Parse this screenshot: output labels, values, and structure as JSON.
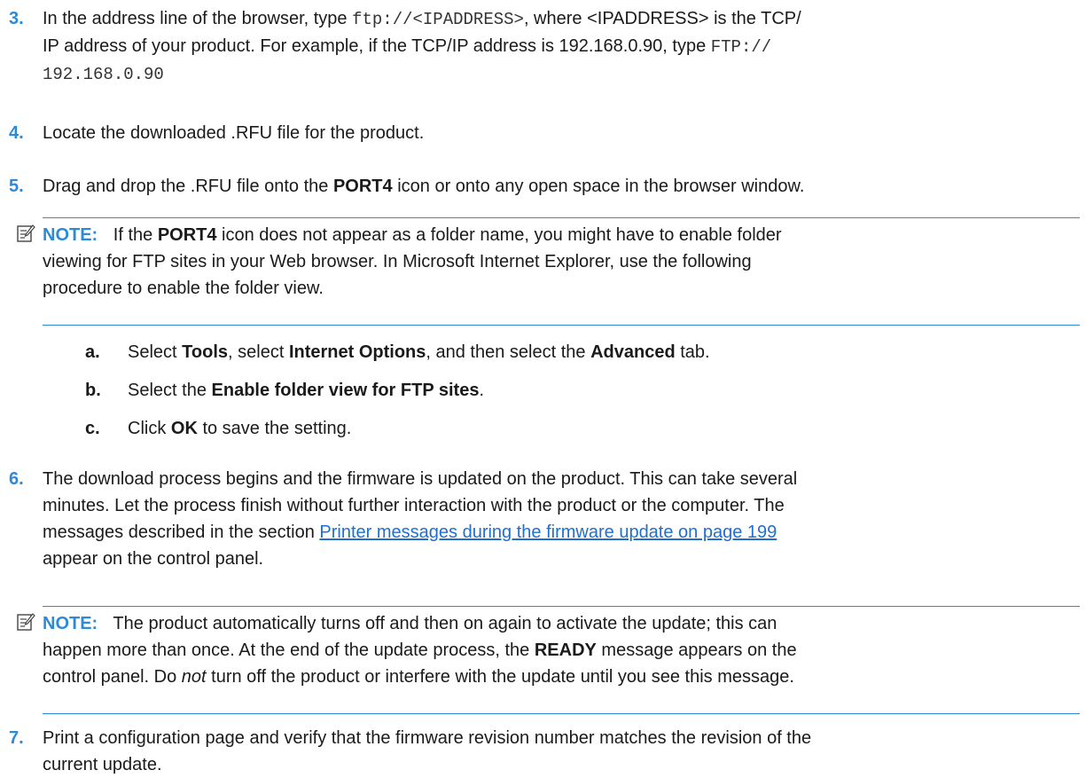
{
  "step3": {
    "number": "3.",
    "t1": "In the address line of the browser, type ",
    "code1": "ftp://<IPADDRESS>",
    "t2": ", where <IPADDRESS> is the TCP/",
    "t3": "IP address of your product. For example, if the TCP/IP address is 192.168.0.90, type ",
    "code2a": "FTP://",
    "code2b": "192.168.0.90"
  },
  "step4": {
    "number": "4.",
    "text": "Locate the downloaded .RFU file for the product."
  },
  "step5": {
    "number": "5.",
    "t1": "Drag and drop the .RFU file onto the ",
    "bold1": "PORT4",
    "t2": " icon or onto any open space in the browser window."
  },
  "note1": {
    "label": "NOTE:",
    "t1": "If the ",
    "bold1": "PORT4",
    "t2": " icon does not appear as a folder name, you might have to enable folder",
    "line2": "viewing for FTP sites in your Web browser. In Microsoft Internet Explorer, use the following",
    "line3": "procedure to enable the folder view."
  },
  "sub_a": {
    "letter": "a.",
    "t1": "Select ",
    "b1": "Tools",
    "t2": ", select ",
    "b2": "Internet Options",
    "t3": ", and then select the ",
    "b3": "Advanced",
    "t4": " tab."
  },
  "sub_b": {
    "letter": "b.",
    "t1": "Select the ",
    "b1": "Enable folder view for FTP sites",
    "t2": "."
  },
  "sub_c": {
    "letter": "c.",
    "t1": "Click ",
    "b1": "OK",
    "t2": " to save the setting."
  },
  "step6": {
    "number": "6.",
    "line1": "The download process begins and the firmware is updated on the product. This can take several",
    "line2": "minutes. Let the process finish without further interaction with the product or the computer. The",
    "line3_pre": "messages described in the section ",
    "link": "Printer messages during the firmware update  on page 199",
    "line4": "appear on the control panel."
  },
  "note2": {
    "label": "NOTE:",
    "line1": "The product automatically turns off and then on again to activate the update; this can",
    "line2_pre": "happen more than once. At the end of the update process, the ",
    "line2_bold": "READY",
    "line2_post": " message appears on the",
    "line3_pre": "control panel. Do ",
    "line3_ital": "not",
    "line3_post": " turn off the product or interfere with the update until you see this message."
  },
  "step7": {
    "number": "7.",
    "line1": "Print a configuration page and verify that the firmware revision number matches the revision of the",
    "line2": "current update."
  },
  "icons": {
    "note_icon": "note-pencil-icon",
    "accent_color": "#2d8ad8"
  }
}
